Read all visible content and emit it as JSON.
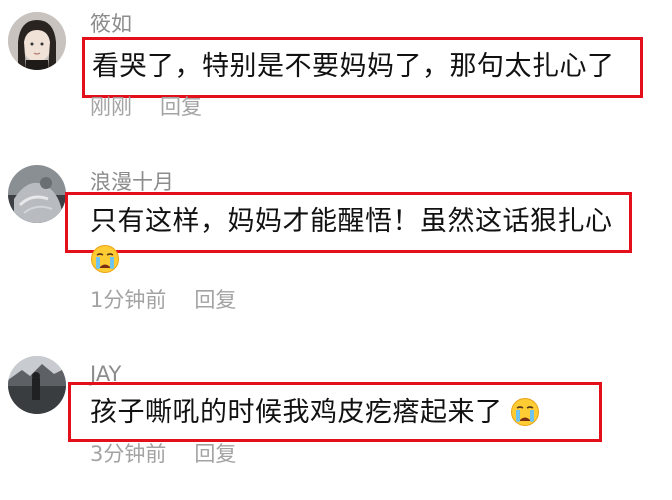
{
  "comments": [
    {
      "username": "筱如",
      "text": "看哭了，特别是不要妈妈了，那句太扎心了",
      "time": "刚刚",
      "reply": "回复",
      "emoji": ""
    },
    {
      "username": "浪漫十月",
      "text": "只有这样，妈妈才能醒悟！虽然这话狠扎心",
      "time": "1分钟前",
      "reply": "回复",
      "emoji": "crying-face-icon"
    },
    {
      "username": "JAY",
      "text": "孩子嘶吼的时候我鸡皮疙瘩起来了",
      "time": "3分钟前",
      "reply": "回复",
      "emoji": "crying-face-icon"
    }
  ],
  "colors": {
    "highlight_box": "#e3101b",
    "username": "#8c8c8c",
    "meta": "#a3a3a3",
    "text": "#111111"
  }
}
